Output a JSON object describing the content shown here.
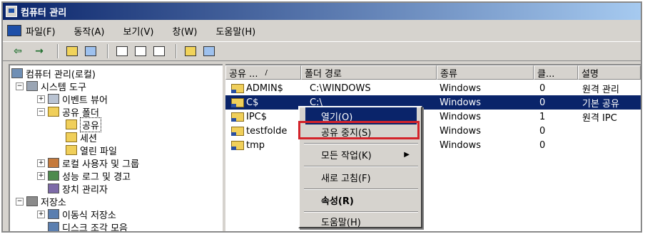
{
  "window": {
    "title": "컴퓨터 관리"
  },
  "menu": [
    "파일(F)",
    "동작(A)",
    "보기(V)",
    "창(W)",
    "도움말(H)"
  ],
  "tree": {
    "root": "컴퓨터 관리(로컬)",
    "system_tools": "시스템 도구",
    "event_viewer": "이벤트 뷰어",
    "shared_folders": "공유 폴더",
    "shares": "공유",
    "sessions": "세션",
    "open_files": "열린 파일",
    "local_users": "로컬 사용자 및 그룹",
    "perf_logs": "성능 로그 및 경고",
    "device_manager": "장치 관리자",
    "storage": "저장소",
    "removable_storage": "이동식 저장소",
    "defrag": "디스크 조각 모음"
  },
  "list": {
    "columns": [
      "공유 ...",
      "폴더 경로",
      "종류",
      "클...",
      "설명"
    ],
    "rows": [
      {
        "name": "ADMIN$",
        "path": "C:\\WINDOWS",
        "type": "Windows",
        "clients": "0",
        "desc": "원격 관리"
      },
      {
        "name": "C$",
        "path": "C:\\",
        "type": "Windows",
        "clients": "0",
        "desc": "기본 공유"
      },
      {
        "name": "IPC$",
        "path": "",
        "type": "Windows",
        "clients": "1",
        "desc": "원격 IPC"
      },
      {
        "name": "testfolde",
        "path": "",
        "type": "Windows",
        "clients": "0",
        "desc": ""
      },
      {
        "name": "tmp",
        "path": "",
        "type": "Windows",
        "clients": "0",
        "desc": ""
      }
    ]
  },
  "context_menu": {
    "open": "열기(O)",
    "stop_sharing": "공유 중지(S)",
    "all_tasks": "모든 작업(K)",
    "refresh": "새로 고침(F)",
    "properties": "속성(R)",
    "help": "도움말(H)"
  },
  "colors": {
    "selection": "#0a246a",
    "highlight_box": "#d3232a",
    "face": "#d6d3ce"
  }
}
